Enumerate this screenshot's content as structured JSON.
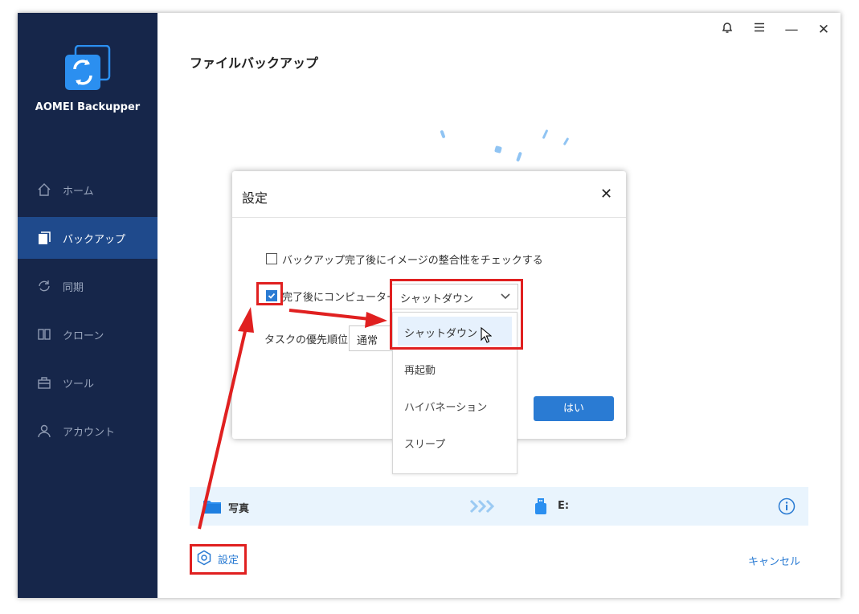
{
  "app": {
    "name": "AOMEI Backupper"
  },
  "window_controls": {
    "bell_icon": "bell-icon",
    "menu_icon": "menu-icon",
    "minimize": "—",
    "close": "✕"
  },
  "sidebar": {
    "items": [
      {
        "label": "ホーム",
        "icon": "home-icon",
        "active": false
      },
      {
        "label": "バックアップ",
        "icon": "backup-icon",
        "active": true
      },
      {
        "label": "同期",
        "icon": "sync-icon",
        "active": false
      },
      {
        "label": "クローン",
        "icon": "clone-icon",
        "active": false
      },
      {
        "label": "ツール",
        "icon": "tools-icon",
        "active": false
      },
      {
        "label": "アカウント",
        "icon": "account-icon",
        "active": false
      }
    ]
  },
  "main": {
    "title": "ファイルバックアップ",
    "task": {
      "source": "写真",
      "destination": "E:"
    },
    "settings_link": "設定",
    "cancel_link": "キャンセル"
  },
  "dialog": {
    "title": "設定",
    "close": "✕",
    "verify_label": "バックアップ完了後にイメージの整合性をチェックする",
    "verify_checked": false,
    "after_label": "完了後にコンピューターを",
    "after_checked": true,
    "after_value": "シャットダウン",
    "priority_label": "タスクの優先順位",
    "priority_value": "通常",
    "ok_button": "はい"
  },
  "dropdown": {
    "options": [
      "シャットダウン",
      "再起動",
      "ハイバネーション",
      "スリープ"
    ],
    "selected_index": 0
  },
  "colors": {
    "sidebar_bg": "#16264a",
    "sidebar_active": "#1f4a8c",
    "accent": "#2a7bd3",
    "annotation_red": "#e02020"
  }
}
